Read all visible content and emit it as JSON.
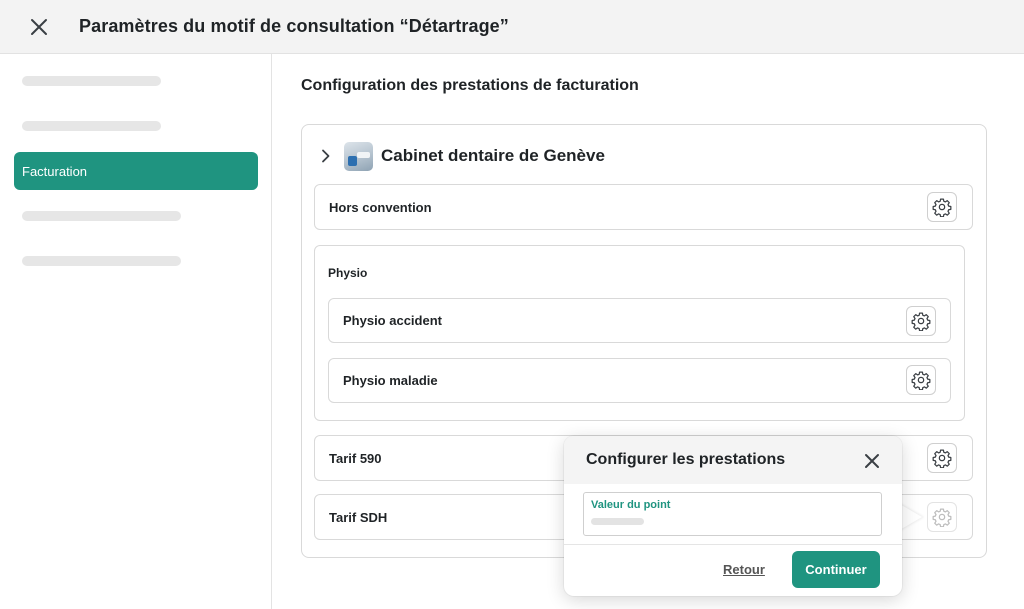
{
  "header": {
    "title": "Paramètres du motif de consultation “Détartrage”"
  },
  "sidebar": {
    "active_item": "Facturation"
  },
  "main": {
    "title": "Configuration des prestations de facturation",
    "cabinet": {
      "name": "Cabinet dentaire de Genève"
    },
    "rows": {
      "hors_convention": "Hors convention",
      "physio_group": "Physio",
      "physio_accident": "Physio accident",
      "physio_maladie": "Physio maladie",
      "tarif_590": "Tarif 590",
      "tarif_sdh": "Tarif SDH"
    }
  },
  "popover": {
    "title": "Configurer les prestations",
    "field_label": "Valeur du point",
    "back_label": "Retour",
    "continue_label": "Continuer"
  },
  "colors": {
    "accent": "#1f9480",
    "header_bg": "#f3f3f3",
    "skeleton": "#e6e6e6"
  },
  "icons": {
    "close": "close-icon",
    "chevron": "chevron-right-icon",
    "gear": "gear-icon",
    "logo": "cabinet-logo"
  }
}
